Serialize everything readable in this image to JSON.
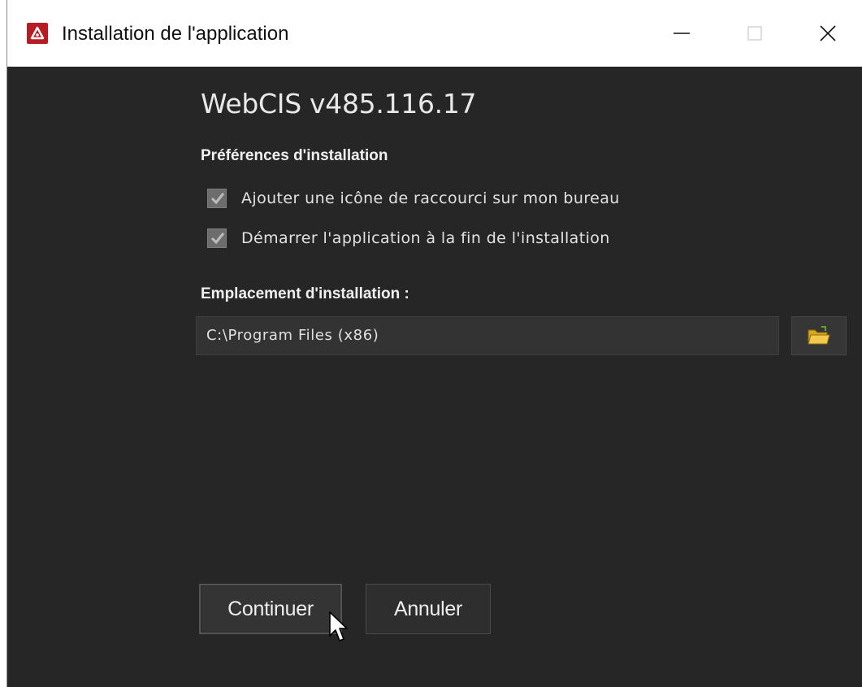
{
  "window": {
    "title": "Installation de l'application",
    "accent_color": "#b81c22"
  },
  "product": {
    "name": "WebCIS v485.116.17"
  },
  "preferences": {
    "label": "Préférences d'installation",
    "options": [
      {
        "label": "Ajouter une icône de raccourci sur mon bureau",
        "checked": true
      },
      {
        "label": "Démarrer l'application à la fin de l'installation",
        "checked": true
      }
    ]
  },
  "location": {
    "label": "Emplacement d'installation :",
    "path": "C:\\Program Files (x86)",
    "browse_icon": "folder-open-icon"
  },
  "actions": {
    "continue_label": "Continuer",
    "cancel_label": "Annuler"
  }
}
